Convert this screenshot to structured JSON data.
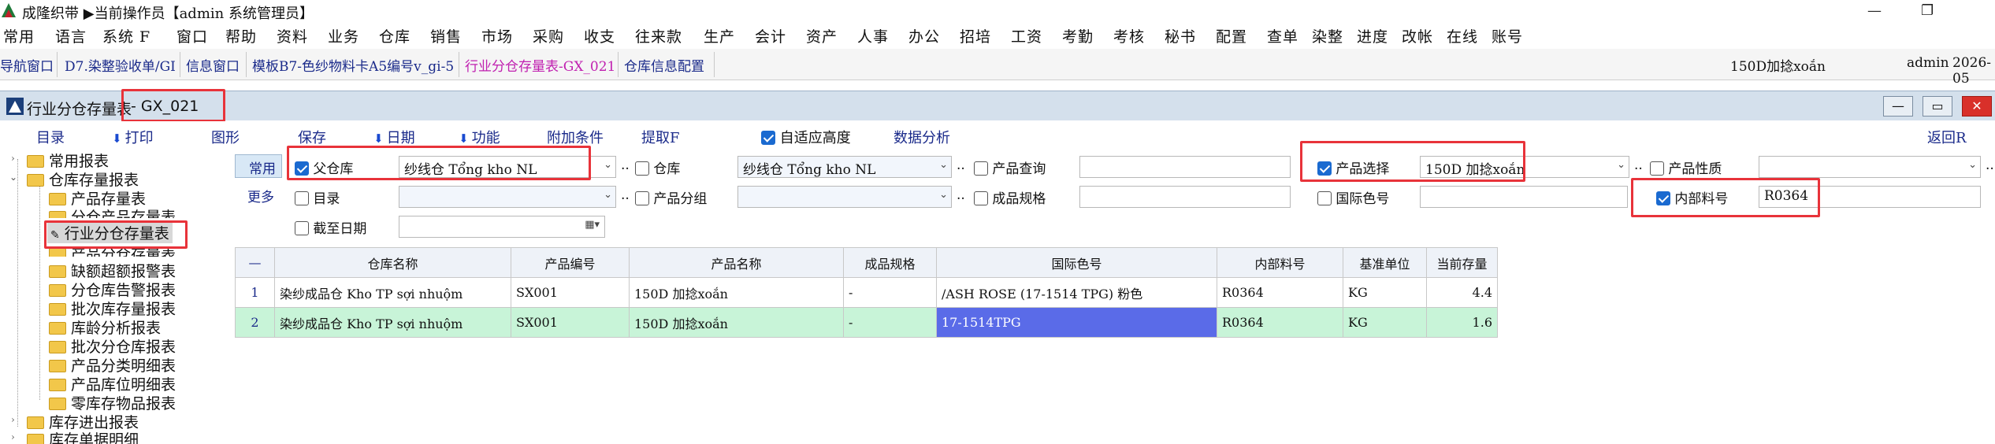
{
  "title_bar": {
    "title": "成隆织带 ▶当前操作员【admin 系统管理员】",
    "minimize": "—",
    "restore": "❐"
  },
  "menu": [
    "常用",
    "语言",
    "系统 F",
    "窗口",
    "帮助",
    "资料",
    "业务",
    "仓库",
    "销售",
    "市场",
    "采购",
    "收支",
    "往来款",
    "生产",
    "会计",
    "资产",
    "人事",
    "办公",
    "招培",
    "工资",
    "考勤",
    "考核",
    "秘书",
    "配置",
    "查单",
    "染整",
    "进度",
    "改帐",
    "在线",
    "账号"
  ],
  "nav_tabs": [
    "导航窗口",
    "D7.染整验收单/GI",
    "信息窗口",
    "模板B7-色纱物料卡A5编号v_gi-5",
    "行业分仓存量表-GX_021",
    "仓库信息配置"
  ],
  "nav_active_index": 4,
  "nav_right": {
    "product": "150D加捻xoắn",
    "user": "admin",
    "date": "2026-05"
  },
  "window": {
    "title": "行业分仓存量表",
    "code": "- GX_021",
    "controls": {
      "minimize": "—",
      "restore": "▭",
      "close": "✕"
    }
  },
  "toolbar": {
    "items": [
      "目录",
      "打印",
      "图形",
      "保存",
      "日期",
      "功能",
      "附加条件",
      "提取F"
    ],
    "autofit_label": "自适应高度",
    "autofit_checked": true,
    "analysis": "数据分析",
    "back": "返回R"
  },
  "tree": [
    {
      "label": "常用报表",
      "level": 1,
      "expanded": false
    },
    {
      "label": "仓库存量报表",
      "level": 1,
      "expanded": true
    },
    {
      "label": "产品存量表",
      "level": 2
    },
    {
      "label": "分仓产品存量表",
      "level": 2
    },
    {
      "label": "行业分仓存量表",
      "level": 2,
      "selected": true
    },
    {
      "label": "产品分仓存量表",
      "level": 2
    },
    {
      "label": "缺额超额报警表",
      "level": 2
    },
    {
      "label": "分仓库告警报表",
      "level": 2
    },
    {
      "label": "批次库存量报表",
      "level": 2
    },
    {
      "label": "库龄分析报表",
      "level": 2
    },
    {
      "label": "批次分仓库报表",
      "level": 2
    },
    {
      "label": "产品分类明细表",
      "level": 2
    },
    {
      "label": "产品库位明细表",
      "level": 2
    },
    {
      "label": "零库存物品报表",
      "level": 2
    },
    {
      "label": "库存进出报表",
      "level": 1,
      "expanded": false
    },
    {
      "label": "库存单据明细",
      "level": 1,
      "expanded": false
    }
  ],
  "filters": {
    "tab_common": "常用",
    "tab_more": "更多",
    "parent_wh": {
      "label": "父仓库",
      "checked": true,
      "value": "纱线仓 Tổng kho NL"
    },
    "warehouse": {
      "label": "仓库",
      "checked": false,
      "value": "纱线仓 Tổng kho NL"
    },
    "product_query": {
      "label": "产品查询",
      "checked": false,
      "value": ""
    },
    "product_select": {
      "label": "产品选择",
      "checked": true,
      "value": "150D 加捻xoắn"
    },
    "product_nature": {
      "label": "产品性质",
      "checked": false,
      "value": ""
    },
    "catalog": {
      "label": "目录",
      "checked": false,
      "value": ""
    },
    "product_group": {
      "label": "产品分组",
      "checked": false,
      "value": ""
    },
    "spec": {
      "label": "成品规格",
      "checked": false,
      "value": ""
    },
    "intl_color": {
      "label": "国际色号",
      "checked": false,
      "value": ""
    },
    "internal_no": {
      "label": "内部料号",
      "checked": true,
      "value": "R0364"
    },
    "cutoff_date": {
      "label": "截至日期",
      "checked": false,
      "value": ""
    },
    "dots": ".."
  },
  "table": {
    "corner": "—",
    "columns": [
      "仓库名称",
      "产品编号",
      "产品名称",
      "成品规格",
      "国际色号",
      "内部料号",
      "基准单位",
      "当前存量"
    ],
    "rows": [
      {
        "idx": "1",
        "cells": [
          "染纱成品仓 Kho TP sợi nhuộm",
          "SX001",
          "150D 加捻xoắn",
          "-",
          "/ASH ROSE (17-1514 TPG) 粉色",
          "R0364",
          "KG",
          "4.4"
        ]
      },
      {
        "idx": "2",
        "cells": [
          "染纱成品仓 Kho TP sợi nhuộm",
          "SX001",
          "150D 加捻xoắn",
          "-",
          "17-1514TPG",
          "R0364",
          "KG",
          "1.6"
        ]
      }
    ]
  },
  "colors": {
    "highlight": "#e8333a",
    "row_alt": "#c8f4d8",
    "selected_cell": "#5a6be8",
    "nav_active": "#c020b0"
  }
}
